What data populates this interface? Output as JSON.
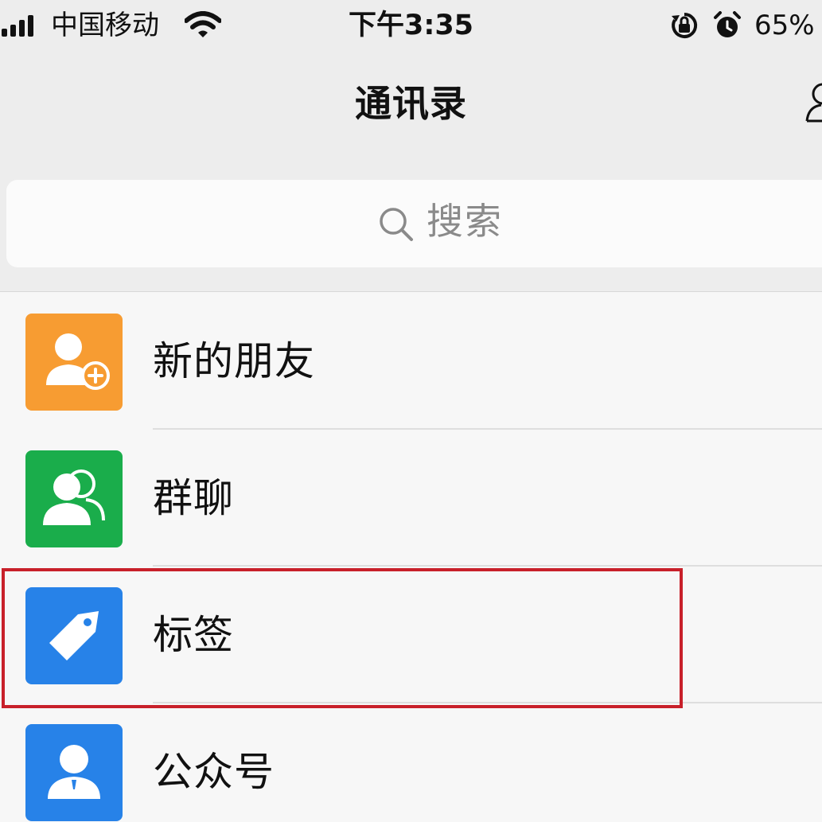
{
  "status_bar": {
    "carrier": "中国移动",
    "time": "下午3:35",
    "battery": "65%"
  },
  "nav": {
    "title": "通讯录"
  },
  "search": {
    "placeholder": "搜索"
  },
  "list": {
    "items": [
      {
        "label": "新的朋友",
        "icon": "new-friend-icon",
        "color": "#f79c32"
      },
      {
        "label": "群聊",
        "icon": "group-chat-icon",
        "color": "#1aad4b"
      },
      {
        "label": "标签",
        "icon": "tag-icon",
        "color": "#2782e8"
      },
      {
        "label": "公众号",
        "icon": "official-account-icon",
        "color": "#2782e8"
      }
    ]
  },
  "highlight": {
    "color": "#c8202a"
  }
}
